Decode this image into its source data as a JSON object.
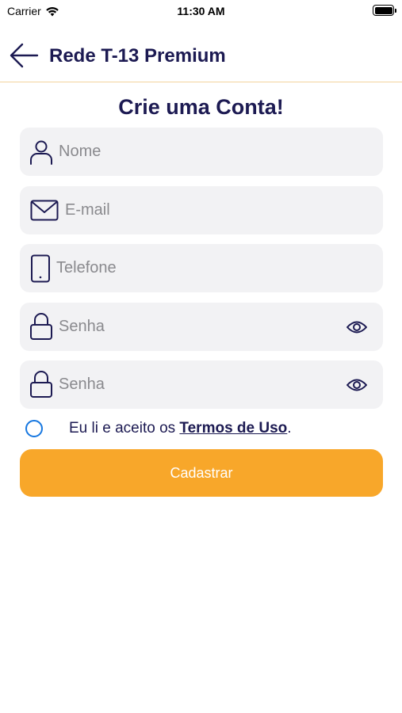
{
  "status_bar": {
    "carrier": "Carrier",
    "time": "11:30 AM"
  },
  "header": {
    "title": "Rede T-13 Premium"
  },
  "page": {
    "title": "Crie uma Conta!"
  },
  "form": {
    "name": {
      "placeholder": "Nome",
      "value": ""
    },
    "email": {
      "placeholder": "E-mail",
      "value": ""
    },
    "phone": {
      "placeholder": "Telefone",
      "value": ""
    },
    "password": {
      "placeholder": "Senha",
      "value": ""
    },
    "password_confirm": {
      "placeholder": "Senha",
      "value": ""
    }
  },
  "terms": {
    "text": "Eu li e aceito os ",
    "link": "Termos de Uso",
    "suffix": "."
  },
  "submit_label": "Cadastrar",
  "colors": {
    "primary": "#1c1a52",
    "accent": "#f8a72a",
    "field_bg": "#f2f2f4",
    "radio": "#1677e0",
    "divider": "#f3d39e"
  },
  "icons": [
    "wifi-icon",
    "battery-icon",
    "back-arrow-icon",
    "user-icon",
    "mail-icon",
    "phone-icon",
    "lock-icon",
    "eye-icon"
  ]
}
